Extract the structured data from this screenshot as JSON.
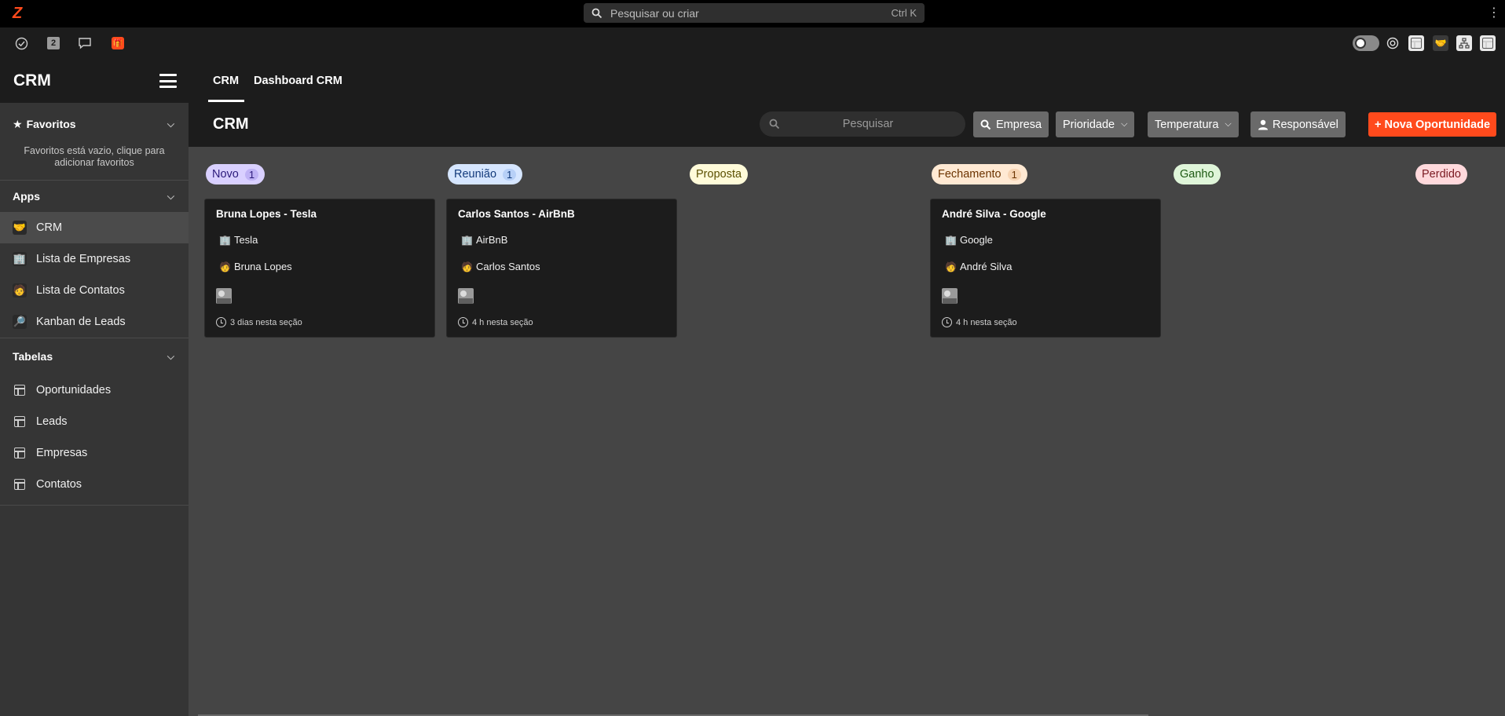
{
  "app": {
    "global_search_placeholder": "Pesquisar ou criar",
    "global_search_shortcut": "Ctrl K",
    "notification_count": "2",
    "accent_color": "#ff4a1c"
  },
  "sidebar": {
    "title": "CRM",
    "favorites": {
      "title": "Favoritos",
      "empty_text": "Favoritos está vazio, clique para adicionar favoritos"
    },
    "apps": {
      "title": "Apps",
      "items": [
        {
          "label": "CRM",
          "icon": "handshake-icon",
          "active": true
        },
        {
          "label": "Lista de Empresas",
          "icon": "building-icon"
        },
        {
          "label": "Lista de Contatos",
          "icon": "person-icon"
        },
        {
          "label": "Kanban de Leads",
          "icon": "magnifier-icon"
        }
      ]
    },
    "tables": {
      "title": "Tabelas",
      "items": [
        {
          "label": "Oportunidades"
        },
        {
          "label": "Leads"
        },
        {
          "label": "Empresas"
        },
        {
          "label": "Contatos"
        }
      ]
    }
  },
  "header": {
    "tabs": [
      {
        "label": "CRM",
        "active": true
      },
      {
        "label": "Dashboard CRM"
      }
    ],
    "page_title": "CRM",
    "search_placeholder": "Pesquisar",
    "filters": {
      "empresa": "Empresa",
      "prioridade": "Prioridade",
      "temperatura": "Temperatura",
      "responsavel": "Responsável"
    },
    "new_button": "Nova Oportunidade"
  },
  "columns": [
    {
      "label": "Novo",
      "count": "1",
      "bg": "#d9d0ff",
      "fg": "#2b1a7a",
      "cnt_bg": "#bfb2f5"
    },
    {
      "label": "Reunião",
      "count": "1",
      "bg": "#d6e6ff",
      "fg": "#123a7a",
      "cnt_bg": "#b7d0f7"
    },
    {
      "label": "Proposta",
      "count": "",
      "bg": "#fffbd9",
      "fg": "#5a4f00",
      "cnt_bg": ""
    },
    {
      "label": "Fechamento",
      "count": "1",
      "bg": "#ffe9d3",
      "fg": "#6b3300",
      "cnt_bg": "#f7d4b3"
    },
    {
      "label": "Ganho",
      "count": "",
      "bg": "#dff5d9",
      "fg": "#1e5a14",
      "cnt_bg": ""
    },
    {
      "label": "Perdido",
      "count": "",
      "bg": "#ffd9dc",
      "fg": "#7a1a22",
      "cnt_bg": ""
    }
  ],
  "cards": [
    {
      "title": "Bruna Lopes - Tesla",
      "company": "Tesla",
      "contact": "Bruna Lopes",
      "time": "3 dias nesta seção"
    },
    {
      "title": "Carlos Santos - AirBnB",
      "company": "AirBnB",
      "contact": "Carlos Santos",
      "time": "4 h nesta seção"
    },
    {
      "title": "André Silva - Google",
      "company": "Google",
      "contact": "André Silva",
      "time": "4 h nesta seção"
    }
  ]
}
